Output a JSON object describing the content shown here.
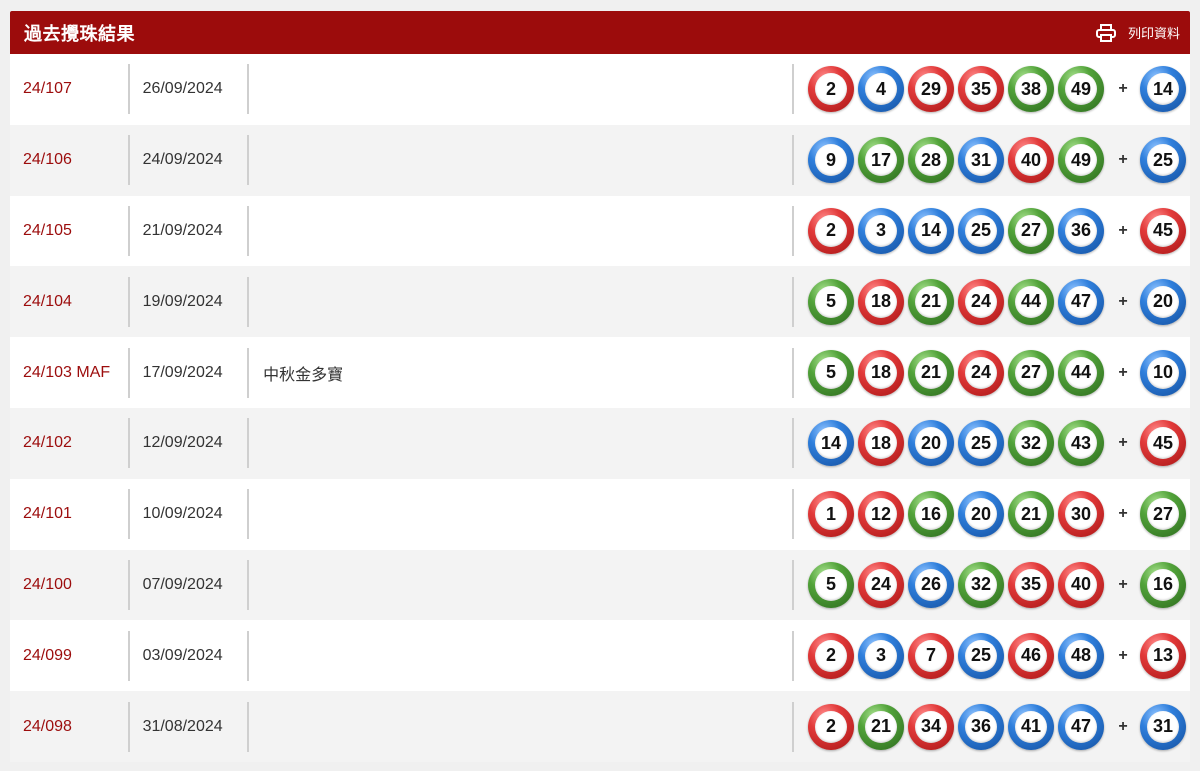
{
  "header": {
    "title": "過去攪珠結果",
    "print_label": "列印資料",
    "print_icon": "printer-icon"
  },
  "colors": {
    "brand": "#9c0c0c",
    "red": "#e23a3a",
    "blue": "#2f7fdc",
    "green": "#52a33a"
  },
  "results": [
    {
      "draw": "24/107",
      "date": "26/09/2024",
      "note": "",
      "balls": [
        {
          "n": "2",
          "c": "red"
        },
        {
          "n": "4",
          "c": "blue"
        },
        {
          "n": "29",
          "c": "red"
        },
        {
          "n": "35",
          "c": "red"
        },
        {
          "n": "38",
          "c": "green"
        },
        {
          "n": "49",
          "c": "green"
        }
      ],
      "plus": "+",
      "extra": {
        "n": "14",
        "c": "blue"
      }
    },
    {
      "draw": "24/106",
      "date": "24/09/2024",
      "note": "",
      "balls": [
        {
          "n": "9",
          "c": "blue"
        },
        {
          "n": "17",
          "c": "green"
        },
        {
          "n": "28",
          "c": "green"
        },
        {
          "n": "31",
          "c": "blue"
        },
        {
          "n": "40",
          "c": "red"
        },
        {
          "n": "49",
          "c": "green"
        }
      ],
      "plus": "+",
      "extra": {
        "n": "25",
        "c": "blue"
      }
    },
    {
      "draw": "24/105",
      "date": "21/09/2024",
      "note": "",
      "balls": [
        {
          "n": "2",
          "c": "red"
        },
        {
          "n": "3",
          "c": "blue"
        },
        {
          "n": "14",
          "c": "blue"
        },
        {
          "n": "25",
          "c": "blue"
        },
        {
          "n": "27",
          "c": "green"
        },
        {
          "n": "36",
          "c": "blue"
        }
      ],
      "plus": "+",
      "extra": {
        "n": "45",
        "c": "red"
      }
    },
    {
      "draw": "24/104",
      "date": "19/09/2024",
      "note": "",
      "balls": [
        {
          "n": "5",
          "c": "green"
        },
        {
          "n": "18",
          "c": "red"
        },
        {
          "n": "21",
          "c": "green"
        },
        {
          "n": "24",
          "c": "red"
        },
        {
          "n": "44",
          "c": "green"
        },
        {
          "n": "47",
          "c": "blue"
        }
      ],
      "plus": "+",
      "extra": {
        "n": "20",
        "c": "blue"
      }
    },
    {
      "draw": "24/103 MAF",
      "date": "17/09/2024",
      "note": "中秋金多寶",
      "balls": [
        {
          "n": "5",
          "c": "green"
        },
        {
          "n": "18",
          "c": "red"
        },
        {
          "n": "21",
          "c": "green"
        },
        {
          "n": "24",
          "c": "red"
        },
        {
          "n": "27",
          "c": "green"
        },
        {
          "n": "44",
          "c": "green"
        }
      ],
      "plus": "+",
      "extra": {
        "n": "10",
        "c": "blue"
      }
    },
    {
      "draw": "24/102",
      "date": "12/09/2024",
      "note": "",
      "balls": [
        {
          "n": "14",
          "c": "blue"
        },
        {
          "n": "18",
          "c": "red"
        },
        {
          "n": "20",
          "c": "blue"
        },
        {
          "n": "25",
          "c": "blue"
        },
        {
          "n": "32",
          "c": "green"
        },
        {
          "n": "43",
          "c": "green"
        }
      ],
      "plus": "+",
      "extra": {
        "n": "45",
        "c": "red"
      }
    },
    {
      "draw": "24/101",
      "date": "10/09/2024",
      "note": "",
      "balls": [
        {
          "n": "1",
          "c": "red"
        },
        {
          "n": "12",
          "c": "red"
        },
        {
          "n": "16",
          "c": "green"
        },
        {
          "n": "20",
          "c": "blue"
        },
        {
          "n": "21",
          "c": "green"
        },
        {
          "n": "30",
          "c": "red"
        }
      ],
      "plus": "+",
      "extra": {
        "n": "27",
        "c": "green"
      }
    },
    {
      "draw": "24/100",
      "date": "07/09/2024",
      "note": "",
      "balls": [
        {
          "n": "5",
          "c": "green"
        },
        {
          "n": "24",
          "c": "red"
        },
        {
          "n": "26",
          "c": "blue"
        },
        {
          "n": "32",
          "c": "green"
        },
        {
          "n": "35",
          "c": "red"
        },
        {
          "n": "40",
          "c": "red"
        }
      ],
      "plus": "+",
      "extra": {
        "n": "16",
        "c": "green"
      }
    },
    {
      "draw": "24/099",
      "date": "03/09/2024",
      "note": "",
      "balls": [
        {
          "n": "2",
          "c": "red"
        },
        {
          "n": "3",
          "c": "blue"
        },
        {
          "n": "7",
          "c": "red"
        },
        {
          "n": "25",
          "c": "blue"
        },
        {
          "n": "46",
          "c": "red"
        },
        {
          "n": "48",
          "c": "blue"
        }
      ],
      "plus": "+",
      "extra": {
        "n": "13",
        "c": "red"
      }
    },
    {
      "draw": "24/098",
      "date": "31/08/2024",
      "note": "",
      "balls": [
        {
          "n": "2",
          "c": "red"
        },
        {
          "n": "21",
          "c": "green"
        },
        {
          "n": "34",
          "c": "red"
        },
        {
          "n": "36",
          "c": "blue"
        },
        {
          "n": "41",
          "c": "blue"
        },
        {
          "n": "47",
          "c": "blue"
        }
      ],
      "plus": "+",
      "extra": {
        "n": "31",
        "c": "blue"
      }
    }
  ]
}
